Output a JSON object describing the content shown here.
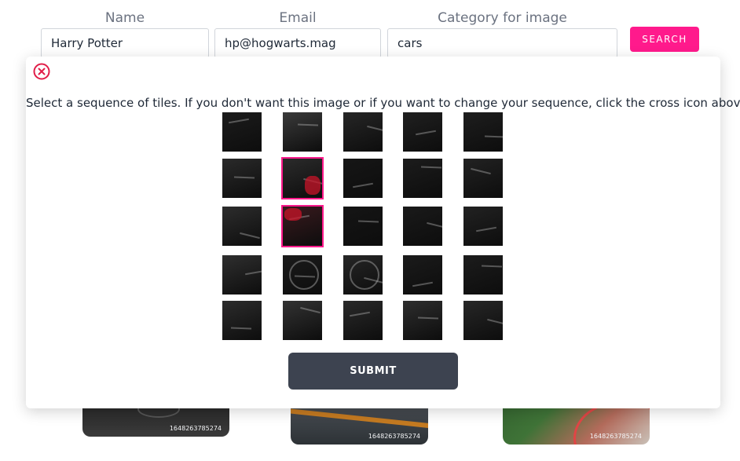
{
  "form": {
    "name_label": "Name",
    "name_value": "Harry Potter",
    "email_label": "Email",
    "email_value": "hp@hogwarts.mag",
    "category_label": "Category for image",
    "category_value": "cars",
    "search_label": "SEARCH"
  },
  "modal": {
    "instruction": "Select a sequence of tiles. If you don't want this image or if you want to change your sequence, click the cross icon above.",
    "submit_label": "SUBMIT",
    "close_icon": "circle-x-icon"
  },
  "tiles": {
    "rows": 5,
    "cols": 5,
    "selected": [
      [
        1,
        1
      ],
      [
        2,
        1
      ]
    ]
  },
  "gallery": [
    {
      "stamp": "1648263785274"
    },
    {
      "stamp": "1648263785274"
    },
    {
      "stamp": "1648263785274"
    }
  ],
  "colors": {
    "accent": "#ff1a8c",
    "submit": "#3d4350",
    "close": "#e11d48"
  }
}
